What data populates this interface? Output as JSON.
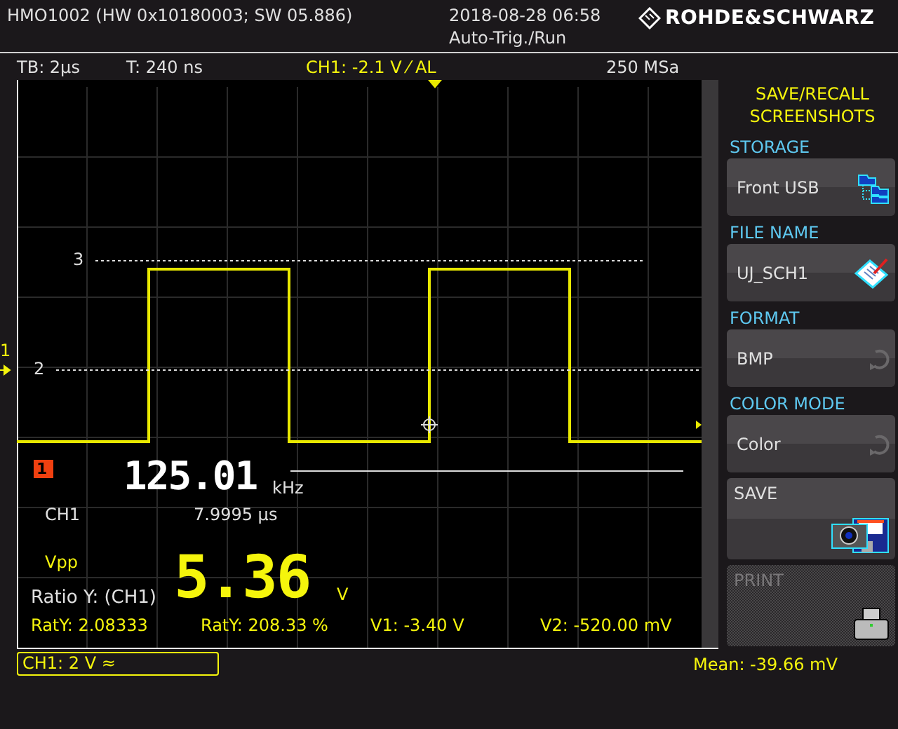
{
  "header": {
    "device": "HMO1002 (HW 0x10180003; SW 05.886)",
    "datetime": "2018-08-28 06:58",
    "trigger_mode": "Auto-Trig./Run",
    "logo": "ROHDE&SCHWARZ"
  },
  "info_bar": [
    {
      "text": "TB: 2µs",
      "kind": "plain"
    },
    {
      "text": "T: 240 ns",
      "kind": "plain"
    },
    {
      "text": "CH1: -2.1 V ⁄ AL",
      "kind": "channel"
    },
    {
      "text": "250 MSa",
      "kind": "plain"
    }
  ],
  "plot": {
    "channel_marker": "1",
    "reference_markers": [
      {
        "label": "3"
      },
      {
        "label": "2"
      }
    ],
    "cursor_marker": "1",
    "measurement": {
      "frequency": "125.01",
      "frequency_unit": "kHz",
      "channel": "CH1",
      "period": "7.9995 µs",
      "label": "Vpp",
      "value": "5.36",
      "unit": "V"
    },
    "ratio": {
      "title": "Ratio Y: (CH1)",
      "values": [
        "RatY: 2.08333",
        "RatY: 208.33 %",
        "V1: -3.40 V",
        "V2: -520.00 mV"
      ]
    }
  },
  "side_menu": {
    "title_lines": [
      "SAVE/RECALL",
      "SCREENSHOTS"
    ],
    "items": [
      {
        "kind": "folder",
        "heading": "STORAGE",
        "value": "Front USB",
        "disabled": false
      },
      {
        "kind": "notepad",
        "heading": "FILE NAME",
        "value": "UJ_SCH1",
        "disabled": false
      },
      {
        "kind": "cycle",
        "heading": "FORMAT",
        "value": "BMP",
        "disabled": false
      },
      {
        "kind": "cycle",
        "heading": "COLOR MODE",
        "value": "Color",
        "disabled": false
      },
      {
        "kind": "camera",
        "value": "SAVE",
        "disabled": false
      },
      {
        "kind": "printer",
        "value": "PRINT",
        "disabled": true
      }
    ]
  },
  "footer": {
    "channel": "CH1: 2 V ≈",
    "mean": "Mean: -39.66 mV"
  }
}
